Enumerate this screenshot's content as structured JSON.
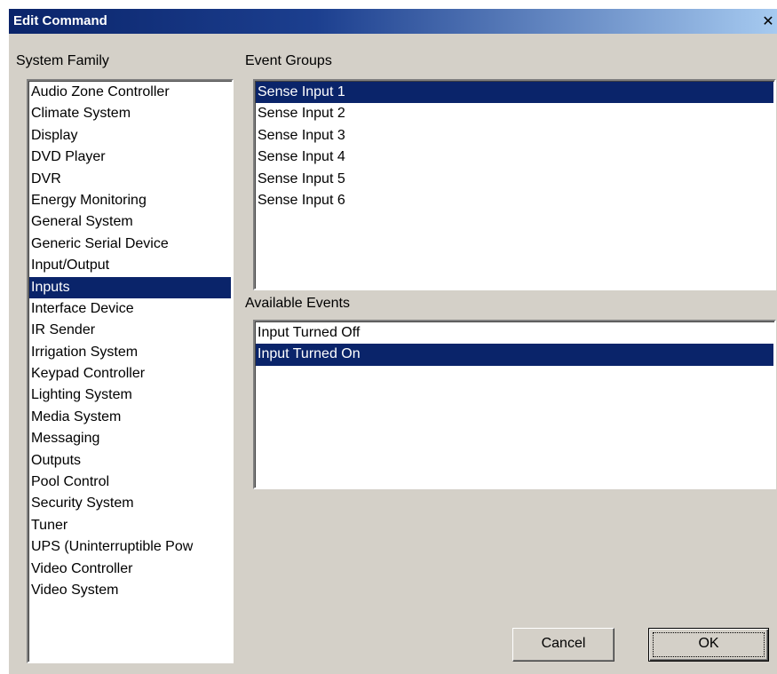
{
  "window": {
    "title": "Edit Command",
    "close_glyph": "✕"
  },
  "system_family": {
    "label": "System Family",
    "selected": "Inputs",
    "items": [
      "Audio Zone Controller",
      "Climate System",
      "Display",
      "DVD Player",
      "DVR",
      "Energy Monitoring",
      "General System",
      "Generic Serial Device",
      "Input/Output",
      "Inputs",
      "Interface Device",
      "IR Sender",
      "Irrigation System",
      "Keypad Controller",
      "Lighting System",
      "Media System",
      "Messaging",
      "Outputs",
      "Pool Control",
      "Security System",
      "Tuner",
      "UPS (Uninterruptible Pow",
      "Video Controller",
      "Video System"
    ]
  },
  "event_groups": {
    "label": "Event Groups",
    "selected": "Sense Input 1",
    "items": [
      "Sense Input 1",
      "Sense Input 2",
      "Sense Input 3",
      "Sense Input 4",
      "Sense Input 5",
      "Sense Input 6"
    ]
  },
  "available_events": {
    "label": "Available Events",
    "selected": "Input Turned On",
    "items": [
      "Input Turned Off",
      "Input Turned On"
    ]
  },
  "buttons": {
    "cancel_label": "Cancel",
    "ok_label": "OK"
  },
  "colors": {
    "dialog_bg": "#d4d0c8",
    "selection": "#0a246a",
    "titlebar_start": "#0a246a",
    "titlebar_end": "#a6caf0"
  },
  "icons": {
    "close": "close-icon"
  }
}
